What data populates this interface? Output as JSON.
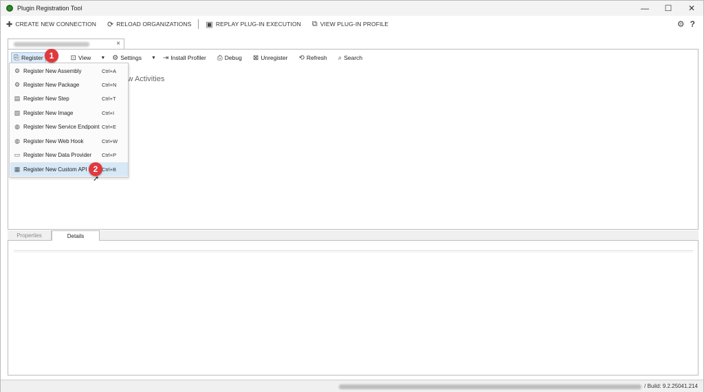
{
  "window": {
    "title": "Plugin Registration Tool"
  },
  "window_controls": {
    "minimize": "—",
    "maximize": "☐",
    "close": "✕"
  },
  "command_bar": {
    "create": {
      "icon": "plus-icon",
      "label": "CREATE NEW CONNECTION"
    },
    "reload": {
      "icon": "reload-icon",
      "label": "RELOAD ORGANIZATIONS"
    },
    "replay": {
      "icon": "replay-icon",
      "label": "REPLAY PLUG-IN EXECUTION"
    },
    "profile": {
      "icon": "profile-icon",
      "label": "VIEW PLUG-IN PROFILE"
    },
    "settings_glyph": "⚙",
    "help_glyph": "?"
  },
  "connection_tab": {
    "close_glyph": "×"
  },
  "toolbar": {
    "register": "Register",
    "view": "View",
    "settings": "Settings",
    "install_profiler": "Install Profiler",
    "debug": "Debug",
    "unregister": "Unregister",
    "refresh": "Refresh",
    "search": "Search",
    "arrow": "▼"
  },
  "main": {
    "partial_text": "low Activities"
  },
  "register_menu": {
    "items": [
      {
        "label": "Register New Assembly",
        "shortcut": "Ctrl+A"
      },
      {
        "label": "Register New Package",
        "shortcut": "Ctrl+N"
      },
      {
        "label": "Register New Step",
        "shortcut": "Ctrl+T"
      },
      {
        "label": "Register New Image",
        "shortcut": "Ctrl+I"
      },
      {
        "label": "Register New Service Endpoint",
        "shortcut": "Ctrl+E"
      },
      {
        "label": "Register New Web Hook",
        "shortcut": "Ctrl+W"
      },
      {
        "label": "Register New Data Provider",
        "shortcut": "Ctrl+P"
      },
      {
        "label": "Register New Custom API",
        "shortcut": "Ctrl+B"
      }
    ],
    "highlighted_index": 7
  },
  "annotations": {
    "step1": "1",
    "step2": "2"
  },
  "bottom_tabs": {
    "properties": "Properties",
    "details": "Details",
    "active": "Details"
  },
  "status": {
    "build": "/ Build: 9.2.25041.214"
  },
  "colors": {
    "accent": "#e0393e",
    "highlight": "#d7e8f6"
  }
}
